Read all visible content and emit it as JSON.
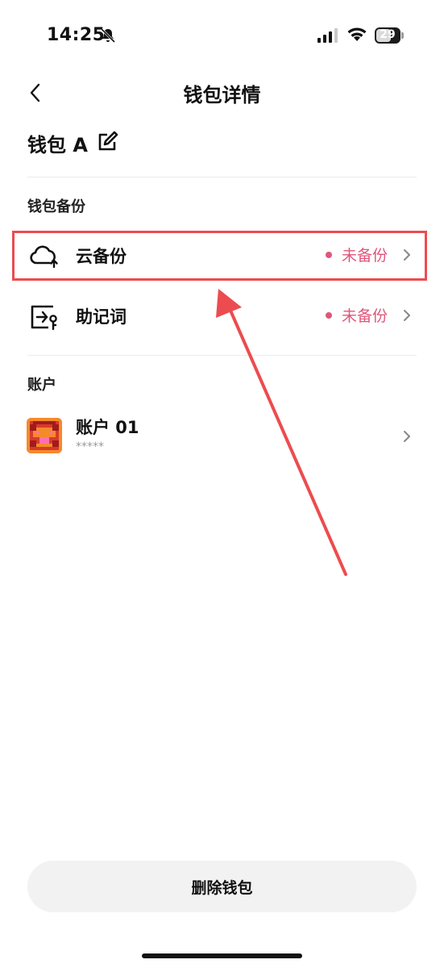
{
  "status_bar": {
    "time": "14:25",
    "battery": "29"
  },
  "nav": {
    "title": "钱包详情"
  },
  "wallet": {
    "name": "钱包 A"
  },
  "backup": {
    "section_label": "钱包备份",
    "items": [
      {
        "label": "云备份",
        "status": "未备份",
        "icon": "cloud-upload-icon"
      },
      {
        "label": "助记词",
        "status": "未备份",
        "icon": "mnemonic-key-icon"
      }
    ]
  },
  "accounts": {
    "section_label": "账户",
    "items": [
      {
        "name": "账户 01",
        "masked": "*****"
      }
    ]
  },
  "actions": {
    "delete_label": "删除钱包"
  },
  "colors": {
    "status": "#e0567a",
    "highlight": "#ec4c4f",
    "button_bg": "#f2f2f2"
  }
}
